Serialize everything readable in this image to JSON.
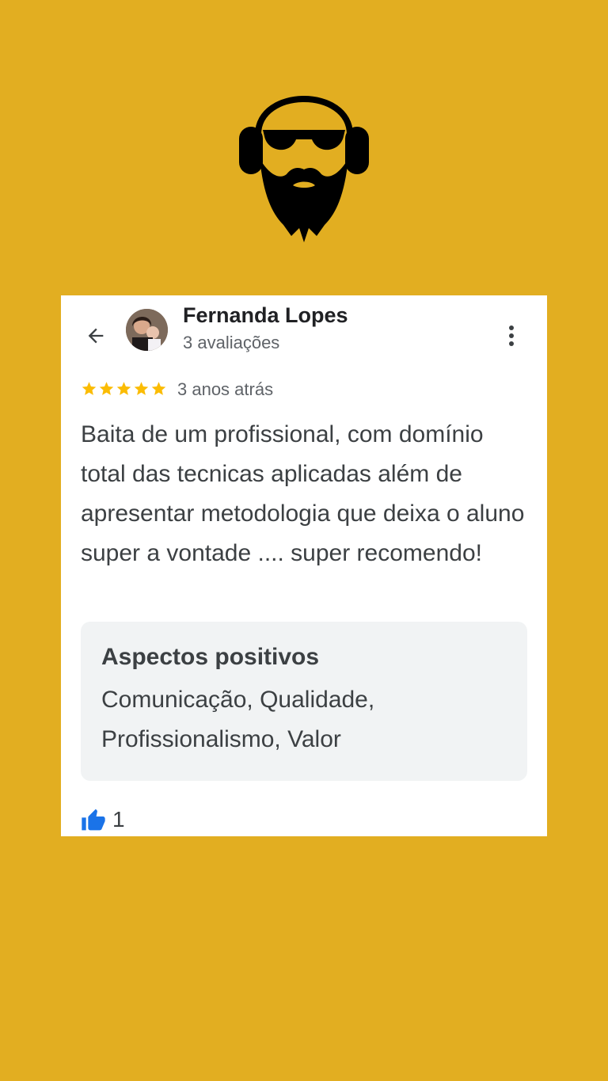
{
  "colors": {
    "background": "#E2AE21",
    "card": "#FFFFFF",
    "star": "#FBBC04",
    "like": "#1A73E8"
  },
  "header": {
    "back_icon": "arrow-left-icon",
    "reviewer_name": "Fernanda Lopes",
    "reviews_count": "3 avaliações",
    "menu_icon": "more-vertical-icon"
  },
  "review": {
    "rating": 5,
    "rating_max": 5,
    "time_ago": "3 anos atrás",
    "text": "Baita de um profissional, com domínio total das tecnicas aplicadas além de apresentar metodologia que deixa o aluno super a vontade .... super recomendo!"
  },
  "aspects": {
    "title": "Aspectos positivos",
    "list": "Comunicação, Qualidade, Profissionalismo, Valor"
  },
  "likes": {
    "icon": "thumbs-up-icon",
    "count": "1"
  }
}
